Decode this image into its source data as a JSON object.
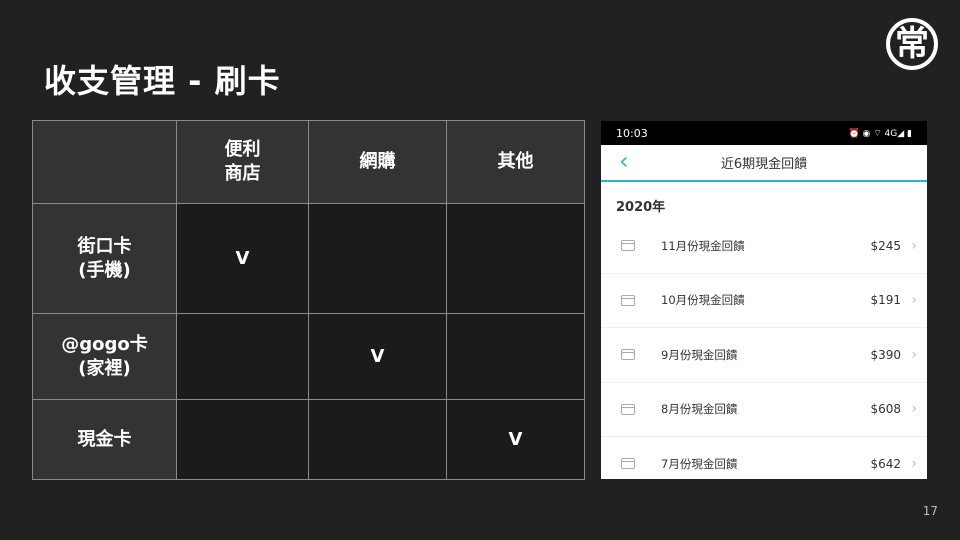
{
  "title": "收支管理 - 刷卡",
  "logo_text": "常",
  "page_number": "17",
  "table": {
    "headers": [
      "",
      "便利\n商店",
      "網購",
      "其他"
    ],
    "rows": [
      {
        "label": "街口卡\n(手機)",
        "cells": [
          "V",
          "",
          ""
        ]
      },
      {
        "label": "@gogo卡\n(家裡)",
        "cells": [
          "",
          "V",
          ""
        ]
      },
      {
        "label": "現金卡",
        "cells": [
          "",
          "",
          "V"
        ]
      }
    ]
  },
  "phone": {
    "time": "10:03",
    "status_icons": "⏰ ◉ ⌔ 4G◢ ▮",
    "nav_title": "近6期現金回饋",
    "year": "2020年",
    "items": [
      {
        "label": "11月份現金回饋",
        "amount": "$245"
      },
      {
        "label": "10月份現金回饋",
        "amount": "$191"
      },
      {
        "label": "9月份現金回饋",
        "amount": "$390"
      },
      {
        "label": "8月份現金回饋",
        "amount": "$608"
      },
      {
        "label": "7月份現金回饋",
        "amount": "$642"
      }
    ]
  }
}
